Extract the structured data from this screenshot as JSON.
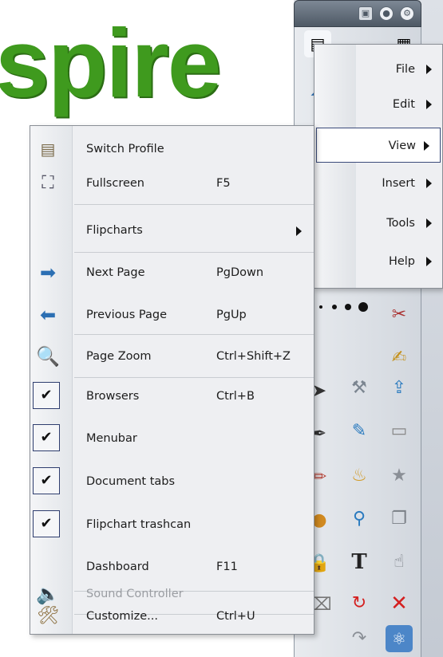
{
  "background": {
    "logo_text": "spire",
    "logo_color": "#3f9a1e"
  },
  "menubar": {
    "items": [
      {
        "label": "File",
        "has_submenu": true
      },
      {
        "label": "Edit",
        "has_submenu": true
      },
      {
        "label": "View",
        "has_submenu": true,
        "active": true
      },
      {
        "label": "Insert",
        "has_submenu": true
      },
      {
        "label": "Tools",
        "has_submenu": true
      },
      {
        "label": "Help",
        "has_submenu": true
      }
    ]
  },
  "view_menu": {
    "items": [
      {
        "label": "Switch Profile",
        "shortcut": "",
        "icon": "profile-icon"
      },
      {
        "label": "Fullscreen",
        "shortcut": "F5",
        "icon": "fullscreen-icon"
      },
      {
        "label": "Flipcharts",
        "shortcut": "",
        "has_submenu": true
      },
      {
        "label": "Next Page",
        "shortcut": "PgDown",
        "icon": "next-page-icon"
      },
      {
        "label": "Previous Page",
        "shortcut": "PgUp",
        "icon": "previous-page-icon"
      },
      {
        "label": "Page Zoom",
        "shortcut": "Ctrl+Shift+Z",
        "icon": "zoom-icon"
      },
      {
        "label": "Browsers",
        "shortcut": "Ctrl+B",
        "checked": true
      },
      {
        "label": "Menubar",
        "shortcut": "",
        "checked": true
      },
      {
        "label": "Document tabs",
        "shortcut": "",
        "checked": true
      },
      {
        "label": "Flipchart trashcan",
        "shortcut": "",
        "checked": true
      },
      {
        "label": "Dashboard",
        "shortcut": "F11"
      },
      {
        "label": "Sound Controller",
        "shortcut": "",
        "icon": "speaker-icon",
        "disabled": true
      },
      {
        "label": "Customize...",
        "shortcut": "Ctrl+U",
        "icon": "customize-icon"
      }
    ],
    "check_glyph": "✔"
  },
  "window": {
    "titlebar_buttons": [
      "restore-icon",
      "minimize-icon",
      "settings-icon"
    ]
  },
  "palette": {
    "tool_text": "T"
  }
}
